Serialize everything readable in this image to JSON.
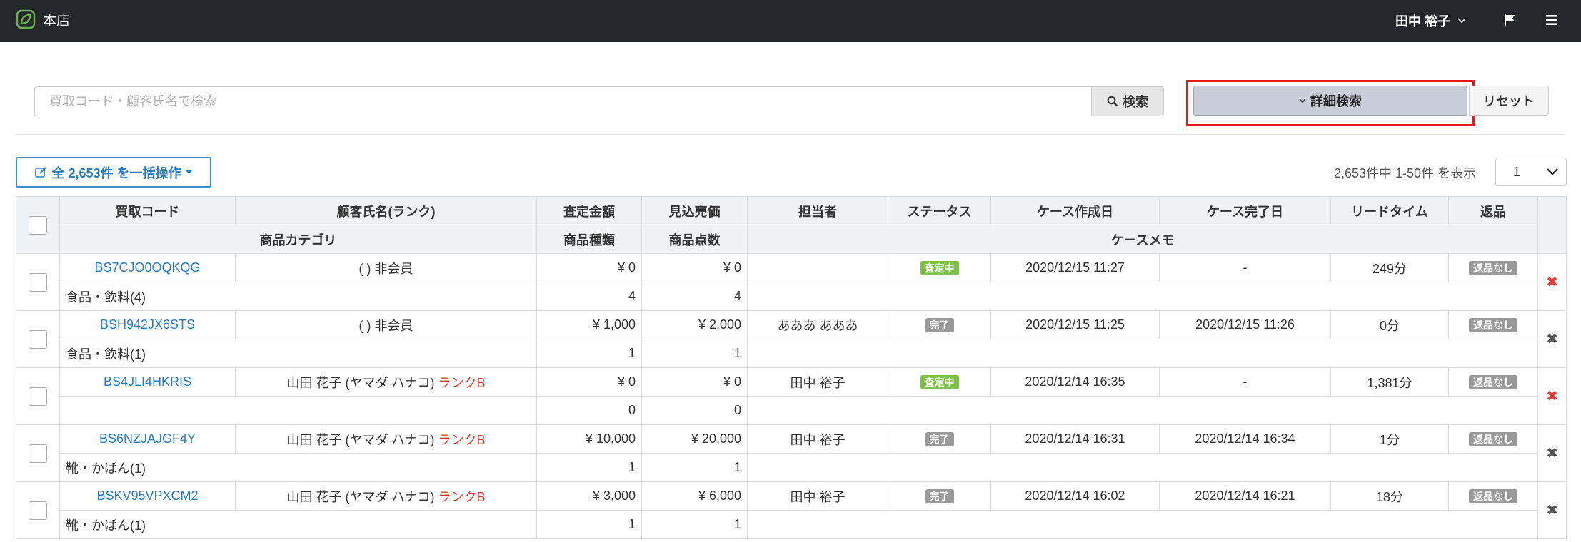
{
  "header": {
    "store": "本店",
    "user": "田中 裕子"
  },
  "search": {
    "placeholder": "買取コード・顧客氏名で検索",
    "search_label": "検索",
    "detail_label": "詳細検索",
    "reset_label": "リセット"
  },
  "toolbar": {
    "bulk_label": "全 2,653件 を一括操作",
    "count_text": "2,653件中 1-50件 を表示",
    "page": "1"
  },
  "table": {
    "headers1": [
      "買取コード",
      "顧客氏名(ランク)",
      "査定金額",
      "見込売価",
      "担当者",
      "ステータス",
      "ケース作成日",
      "ケース完了日",
      "リードタイム",
      "返品"
    ],
    "headers2": [
      "商品カテゴリ",
      "商品種類",
      "商品点数",
      "ケースメモ"
    ],
    "rows": [
      {
        "code": "BS7CJO0OQKQG",
        "customer": "( ) 非会員",
        "rank": "",
        "assess": "¥ 0",
        "expected": "¥ 0",
        "staff": "",
        "status": "査定中",
        "created": "2020/12/15 11:27",
        "completed": "-",
        "lead": "249分",
        "returns": "返品なし",
        "category": "食品・飲料(4)",
        "kinds": "4",
        "points": "4",
        "memo": "",
        "x": "✖"
      },
      {
        "code": "BSH942JX6STS",
        "customer": "( ) 非会員",
        "rank": "",
        "assess": "¥ 1,000",
        "expected": "¥ 2,000",
        "staff": "あああ あああ",
        "status": "完了",
        "created": "2020/12/15 11:25",
        "completed": "2020/12/15 11:26",
        "lead": "0分",
        "returns": "返品なし",
        "category": "食品・飲料(1)",
        "kinds": "1",
        "points": "1",
        "memo": "",
        "x": "✖"
      },
      {
        "code": "BS4JLI4HKRIS",
        "customer": "山田 花子 (ヤマダ ハナコ)",
        "rank": "ランクB",
        "assess": "¥ 0",
        "expected": "¥ 0",
        "staff": "田中 裕子",
        "status": "査定中",
        "created": "2020/12/14 16:35",
        "completed": "-",
        "lead": "1,381分",
        "returns": "返品なし",
        "category": "",
        "kinds": "0",
        "points": "0",
        "memo": "",
        "x": "✖"
      },
      {
        "code": "BS6NZJAJGF4Y",
        "customer": "山田 花子 (ヤマダ ハナコ)",
        "rank": "ランクB",
        "assess": "¥ 10,000",
        "expected": "¥ 20,000",
        "staff": "田中 裕子",
        "status": "完了",
        "created": "2020/12/14 16:31",
        "completed": "2020/12/14 16:34",
        "lead": "1分",
        "returns": "返品なし",
        "category": "靴・かばん(1)",
        "kinds": "1",
        "points": "1",
        "memo": "",
        "x": "✖"
      },
      {
        "code": "BSKV95VPXCM2",
        "customer": "山田 花子 (ヤマダ ハナコ)",
        "rank": "ランクB",
        "assess": "¥ 3,000",
        "expected": "¥ 6,000",
        "staff": "田中 裕子",
        "status": "完了",
        "created": "2020/12/14 16:02",
        "completed": "2020/12/14 16:21",
        "lead": "18分",
        "returns": "返品なし",
        "category": "靴・かばん(1)",
        "kinds": "1",
        "points": "1",
        "memo": "",
        "x": "✖"
      }
    ]
  }
}
